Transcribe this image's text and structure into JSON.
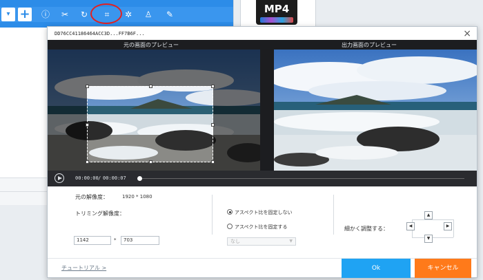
{
  "toolbar": {
    "dropdown_glyph": "▾",
    "add_glyph": "+",
    "icons": [
      "info-icon",
      "cut-icon",
      "rotate-icon",
      "crop-icon",
      "effect-icon",
      "watermark-icon",
      "edit-icon"
    ]
  },
  "format_card": {
    "label": "MP4"
  },
  "dialog": {
    "title": "DD76CC41186464ACC3D...FF7B6F...",
    "close_glyph": "×",
    "preview": {
      "original_label": "元の画面のプレビュー",
      "output_label": "出力画面のプレビュー",
      "current_time": "00:00:00",
      "separator": "/",
      "duration": "00:00:07"
    },
    "settings": {
      "original_resolution_label": "元の解像度：",
      "original_resolution_value": "1920 * 1080",
      "trim_resolution_label": "トリミング解像度：",
      "width_value": "1142",
      "times_sign": "*",
      "height_value": "703",
      "aspect_free_label": "アスペクト比を固定しない",
      "aspect_fixed_label": "アスペクト比を固定する",
      "aspect_select_value": "なし",
      "fine_adjust_label": "細かく調整する："
    },
    "footer": {
      "tutorial_link": "チュートリアル >",
      "ok_label": "Ok",
      "cancel_label": "キャンセル"
    }
  },
  "colors": {
    "toolbar_blue": "#2c8ce8",
    "ok_blue": "#1fa3f3",
    "cancel_orange": "#ff7a1a",
    "highlight_red": "#e32020"
  }
}
